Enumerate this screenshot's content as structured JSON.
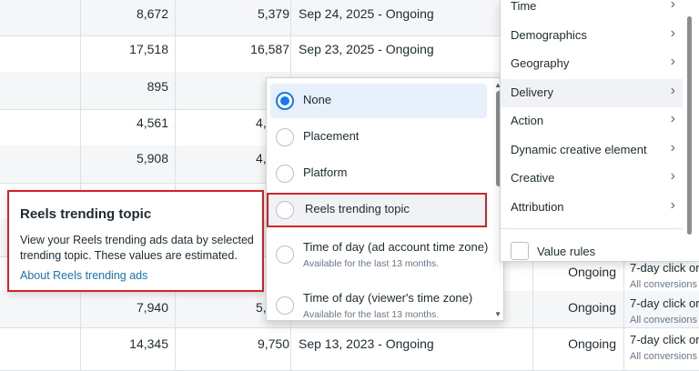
{
  "rows": [
    {
      "col1": "8,672",
      "col2": "5,379",
      "date": "Sep 24, 2025 - Ongoing",
      "status": "",
      "conv": "",
      "conv_sub": ""
    },
    {
      "col1": "17,518",
      "col2": "16,587",
      "date": "Sep 23, 2025 - Ongoing",
      "status": "",
      "conv": "",
      "conv_sub": ""
    },
    {
      "col1": "895",
      "col2": "",
      "date": "",
      "status": "",
      "conv": "",
      "conv_sub": ""
    },
    {
      "col1": "4,561",
      "col2": "4,",
      "date": "",
      "status": "",
      "conv": "",
      "conv_sub": ""
    },
    {
      "col1": "5,908",
      "col2": "4,(",
      "date": "",
      "status": "",
      "conv": "",
      "conv_sub": ""
    },
    {
      "col1": "",
      "col2": "",
      "date": "",
      "status": "",
      "conv": "",
      "conv_sub": ""
    },
    {
      "col1": "",
      "col2": "",
      "date": "",
      "status": "Ongoing",
      "conv": "7-day click or",
      "conv_sub": "All conversions"
    },
    {
      "col1": "7,940",
      "col2": "5,",
      "date": "",
      "status": "Ongoing",
      "conv": "7-day click or",
      "conv_sub": "All conversions"
    },
    {
      "col1": "14,345",
      "col2": "9,750",
      "date": "Sep 13, 2023 - Ongoing",
      "status": "Ongoing",
      "conv": "7-day click or",
      "conv_sub": "All conversions"
    }
  ],
  "tooltip": {
    "title": "Reels trending topic",
    "body": "View your Reels trending ads data by selected trending topic. These values are estimated.",
    "link": "About Reels trending ads"
  },
  "menu": {
    "options": [
      {
        "label": "None",
        "sub": "",
        "selected": true
      },
      {
        "label": "Placement",
        "sub": ""
      },
      {
        "label": "Platform",
        "sub": ""
      },
      {
        "label": "Reels trending topic",
        "sub": "",
        "highlighted": true
      },
      {
        "label": "Time of day (ad account time zone)",
        "sub": "Available for the last 13 months."
      },
      {
        "label": "Time of day (viewer's time zone)",
        "sub": "Available for the last 13 months."
      }
    ]
  },
  "categories": {
    "items": [
      "Time",
      "Demographics",
      "Geography",
      "Delivery",
      "Action",
      "Dynamic creative element",
      "Creative",
      "Attribution"
    ],
    "active": "Delivery",
    "value_rules": "Value rules"
  },
  "colors": {
    "accent": "#1877f2",
    "highlight_border": "#d0242b",
    "link": "#1a73b8"
  }
}
